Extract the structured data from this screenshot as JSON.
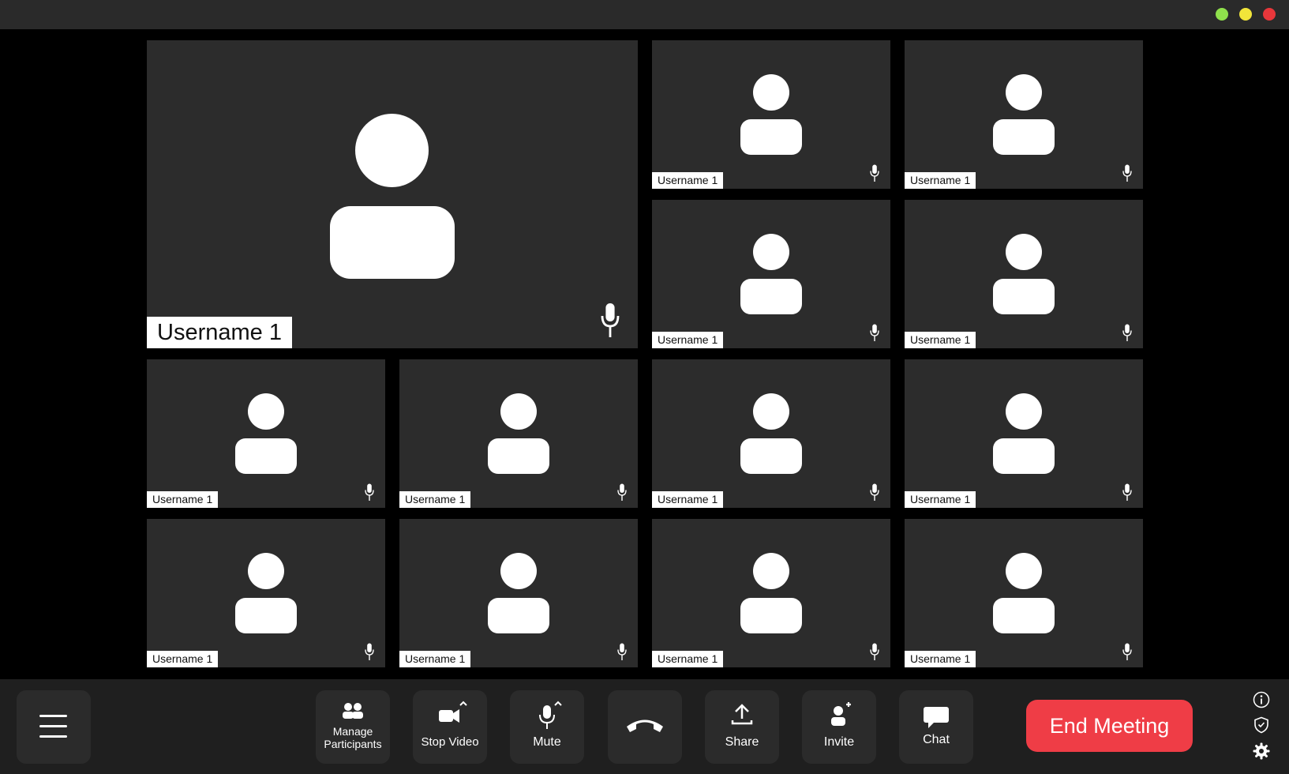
{
  "window": {
    "controls": [
      "green-dot",
      "yellow-dot",
      "red-dot"
    ],
    "colors": {
      "green": "#8fe04c",
      "yellow": "#f1e53a",
      "red": "#e8373b"
    }
  },
  "main_tile": {
    "username": "Username 1",
    "icon": "user-icon",
    "mic": "microphone-icon"
  },
  "tiles": [
    {
      "username": "Username 1"
    },
    {
      "username": "Username 1"
    },
    {
      "username": "Username 1"
    },
    {
      "username": "Username 1"
    },
    {
      "username": "Username 1"
    },
    {
      "username": "Username 1"
    },
    {
      "username": "Username 1"
    },
    {
      "username": "Username 1"
    },
    {
      "username": "Username 1"
    },
    {
      "username": "Username 1"
    },
    {
      "username": "Username 1"
    },
    {
      "username": "Username 1"
    }
  ],
  "toolbar": {
    "menu_icon": "hamburger-menu-icon",
    "manage_participants_line1": "Manage",
    "manage_participants_line2": "Participants",
    "stop_video": "Stop Video",
    "mute": "Mute",
    "hang_up_icon": "phone-hangup-icon",
    "share": "Share",
    "invite": "Invite",
    "chat": "Chat",
    "end_meeting": "End Meeting",
    "end_color": "#ef3d46",
    "side_icons": [
      "info-icon",
      "shield-icon",
      "gear-icon"
    ]
  }
}
